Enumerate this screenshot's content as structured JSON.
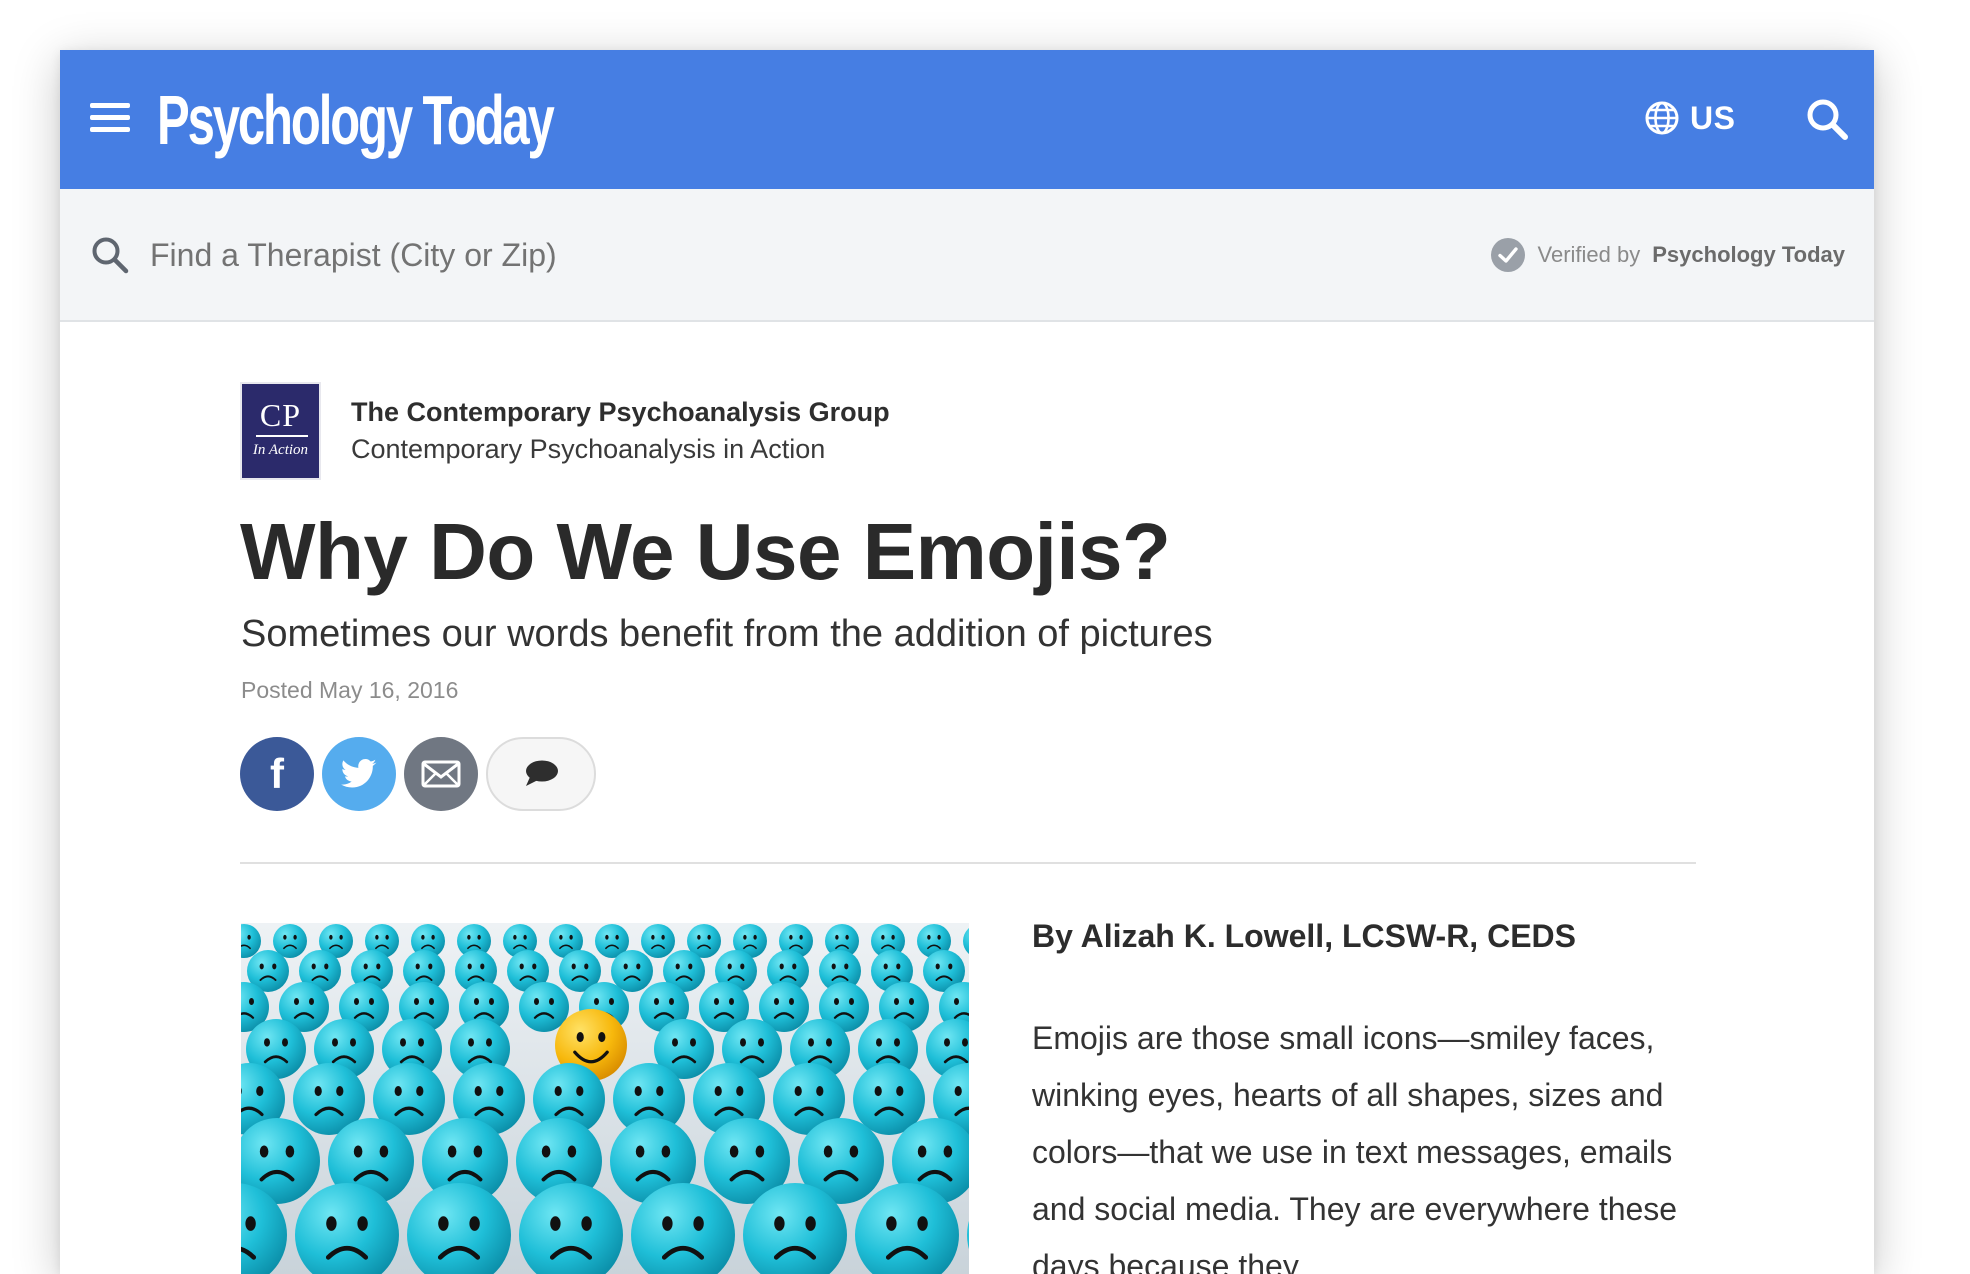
{
  "header": {
    "logo_text": "Psychology Today",
    "region_label": "US",
    "icons": [
      "menu-icon",
      "globe-icon",
      "search-icon"
    ],
    "background_color": "#467ee3"
  },
  "therapist_search": {
    "placeholder": "Find a Therapist (City or Zip)",
    "verified_prefix": "Verified by",
    "verified_brand": "Psychology Today"
  },
  "article": {
    "blog_logo": {
      "line1": "CP",
      "line2": "In Action"
    },
    "group_name": "The Contemporary Psychoanalysis Group",
    "blog_name": "Contemporary Psychoanalysis in Action",
    "title": "Why Do We Use Emojis?",
    "subtitle": "Sometimes our words benefit from the addition of pictures",
    "posted": "Posted May 16, 2016",
    "share_buttons": [
      "facebook-icon",
      "twitter-icon",
      "email-icon",
      "comment-icon"
    ],
    "byline": "By Alizah K. Lowell, LCSW-R, CEDS",
    "body": "Emojis are those small icons—smiley faces, winking eyes, hearts of all shapes, sizes and colors—that we use in text messages, emails and social media. They are everywhere these days because they"
  }
}
